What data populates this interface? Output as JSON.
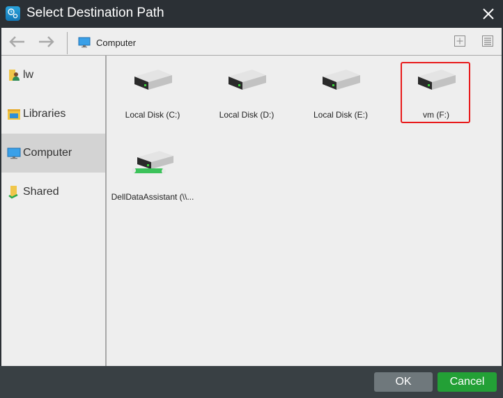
{
  "window": {
    "title": "Select Destination Path",
    "app_icon": "backup-gears-icon",
    "close_icon": "close-icon"
  },
  "toolbar": {
    "back_icon": "arrow-left-icon",
    "forward_icon": "arrow-right-icon",
    "breadcrumb": {
      "icon": "monitor-icon",
      "label": "Computer"
    },
    "new_folder_icon": "new-folder-icon",
    "view_list_icon": "list-view-icon"
  },
  "sidebar": {
    "items": [
      {
        "label": "lw",
        "icon": "user-folder-icon",
        "active": false
      },
      {
        "label": "Libraries",
        "icon": "libraries-icon",
        "active": false
      },
      {
        "label": "Computer",
        "icon": "monitor-icon",
        "active": true
      },
      {
        "label": "Shared",
        "icon": "shared-folder-icon",
        "active": false
      }
    ]
  },
  "drives": [
    {
      "label": "Local Disk (C:)",
      "icon": "hard-drive-icon",
      "selected": false
    },
    {
      "label": "Local Disk (D:)",
      "icon": "hard-drive-icon",
      "selected": false
    },
    {
      "label": "Local Disk (E:)",
      "icon": "hard-drive-icon",
      "selected": false
    },
    {
      "label": "vm (F:)",
      "icon": "hard-drive-icon",
      "selected": true
    },
    {
      "label": "DellDataAssistant (\\\\...",
      "icon": "network-drive-icon",
      "selected": false
    }
  ],
  "footer": {
    "ok_label": "OK",
    "cancel_label": "Cancel"
  },
  "colors": {
    "titlebar": "#2b3035",
    "footer": "#394044",
    "panel": "#eeeeee",
    "active_item": "#d3d3d3",
    "ok_button": "#6f787c",
    "cancel_button": "#23a036",
    "selection_border": "#e8191a"
  }
}
